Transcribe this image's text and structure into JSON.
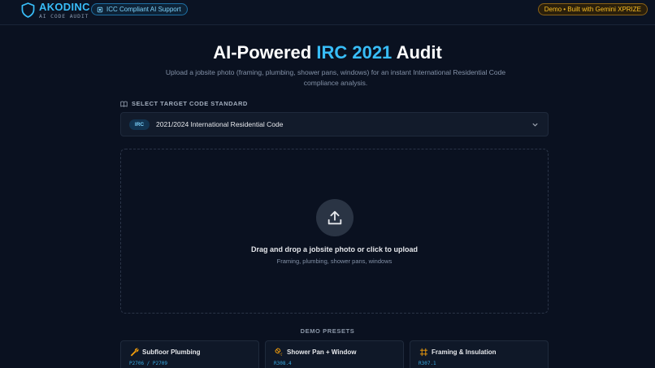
{
  "header": {
    "brand_name": "AKODINC",
    "brand_sub": "AI CODE AUDIT",
    "icc_pill": "ICC Compliant AI Support",
    "demo_pill": "Demo • Built with Gemini XPRIZE"
  },
  "hero": {
    "title_pre": "AI-Powered ",
    "title_accent": "IRC 2021",
    "title_post": " Audit",
    "subtitle": "Upload a jobsite photo (framing, plumbing, shower pans, windows) for an instant International Residential Code compliance analysis."
  },
  "code_standard": {
    "label": "SELECT TARGET CODE STANDARD",
    "badge": "IRC",
    "selected": "2021/2024 International Residential Code"
  },
  "dropzone": {
    "title": "Drag and drop a jobsite photo or click to upload",
    "subtitle": "Framing, plumbing, shower pans, windows"
  },
  "presets": {
    "label": "DEMO PRESETS",
    "items": [
      {
        "title": "Subfloor Plumbing",
        "code": "P2706 / P2709",
        "icon": "wrench-icon"
      },
      {
        "title": "Shower Pan + Window",
        "code": "R308.4",
        "icon": "shower-icon"
      },
      {
        "title": "Framing & Insulation",
        "code": "R307.1",
        "icon": "frame-icon"
      }
    ]
  },
  "colors": {
    "background": "#0a1120",
    "accent": "#38bdf8",
    "demo_amber": "#fbbf24"
  }
}
